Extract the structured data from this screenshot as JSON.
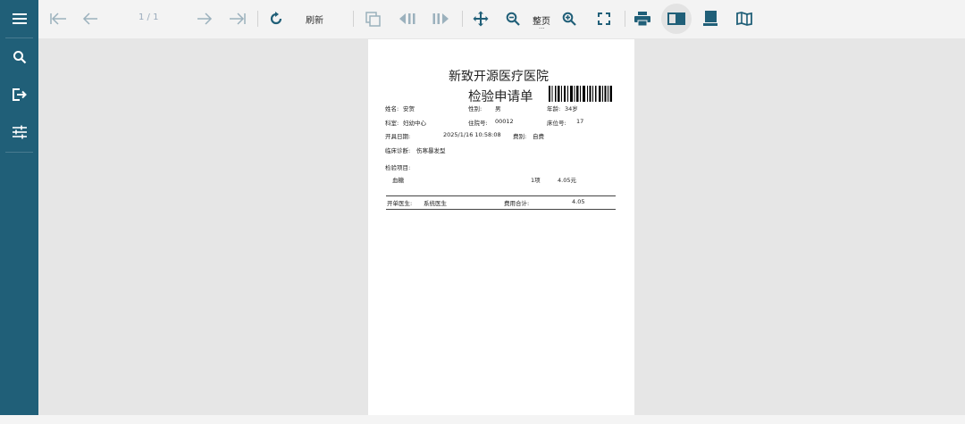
{
  "toolbar": {
    "page_indicator": "1 / 1",
    "refresh_label": "刷新",
    "fit_page_label": "整页",
    "fit_page_sub": "..."
  },
  "report": {
    "hospital_name": "新致开源医疗医院",
    "doc_title": "检验申请单",
    "name_label": "姓名:",
    "name_value": "安贺",
    "gender_label": "性别:",
    "gender_value": "男",
    "age_label": "年龄:",
    "age_value": "34岁",
    "dept_label": "科室:",
    "dept_value": "妇幼中心",
    "admission_label": "住院号:",
    "admission_value": "00012",
    "bed_label": "床位号:",
    "bed_value": "17",
    "date_label": "开具日期:",
    "date_value": "2025/1/16 10:58:08",
    "fee_type_label": "费别:",
    "fee_type_value": "自费",
    "diagnosis_label": "临床诊断:",
    "diagnosis_value": "伤寒暴发型",
    "items_label": "检验项目:",
    "items": [
      {
        "name": "血糖",
        "qty": "1项",
        "price": "4.05元"
      }
    ],
    "doctor_label": "开单医生:",
    "doctor_value": "系统医生",
    "total_label": "费用合计:",
    "total_value": "4.05"
  },
  "colors": {
    "sidebar_bg": "#205f78",
    "toolbar_bg": "#f3f3f3",
    "viewer_bg": "#e6e6e6",
    "accent_icon": "#205f78"
  },
  "icons": {
    "sidebar": [
      "menu-icon",
      "search-icon",
      "export-icon",
      "settings-sliders-icon"
    ],
    "toolbar": [
      "first-page-icon",
      "prev-page-icon",
      "next-page-icon",
      "last-page-icon",
      "refresh-icon",
      "copy-icon",
      "prev-section-icon",
      "next-section-icon",
      "pan-icon",
      "zoom-out-icon",
      "zoom-in-icon",
      "fullscreen-icon",
      "print-icon",
      "book-view-icon",
      "single-page-icon",
      "map-icon"
    ]
  }
}
